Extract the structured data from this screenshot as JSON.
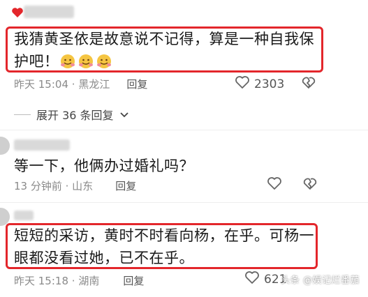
{
  "comments": [
    {
      "text": "我猜黄圣依是故意说不记得，算是一种自我保护吧！",
      "emojis": [
        "hug-emoji",
        "hug-emoji",
        "hug-emoji"
      ],
      "time": "昨天 15:04",
      "location": "黑龙江",
      "reply_label": "回复",
      "likes": "2303"
    },
    {
      "text": "等一下，他俩办过婚礼吗？",
      "time": "13 分钟前",
      "location": "山东",
      "reply_label": "回复",
      "likes": ""
    },
    {
      "text": "短短的采访，黄时不时看向杨，在乎。可杨一眼都没看过她，已不在乎。",
      "time": "昨天 15:18",
      "location": "湖南",
      "reply_label": "回复",
      "likes": "621"
    }
  ],
  "expand_replies_label": "展开 36 条回复",
  "watermark": "头条 @娱记烂番茄",
  "colors": {
    "highlight": "#e3262b",
    "meta": "#8a8a8a",
    "text": "#1a1a1a"
  }
}
